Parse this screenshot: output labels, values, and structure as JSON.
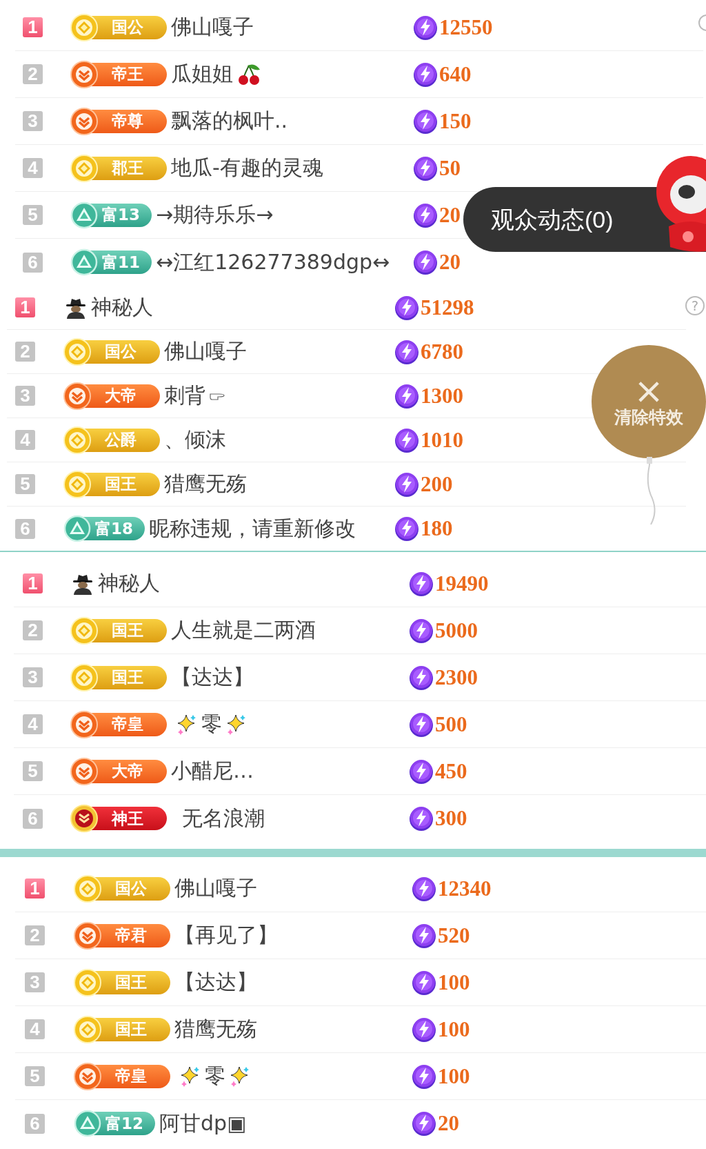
{
  "sections": [
    {
      "help_edge": true,
      "rows": [
        {
          "rank": "1",
          "top": true,
          "kind": "member",
          "badge": {
            "kind": "gold",
            "label": "国公"
          },
          "name": {
            "text": "佛山嘎子",
            "kind": "plain"
          },
          "score": "12550"
        },
        {
          "rank": "2",
          "top": false,
          "kind": "member",
          "badge": {
            "kind": "orange",
            "label": "帝王"
          },
          "name": {
            "text": "瓜姐姐",
            "kind": "cherry"
          },
          "score": "640"
        },
        {
          "rank": "3",
          "top": false,
          "kind": "member",
          "badge": {
            "kind": "orange",
            "label": "帝尊"
          },
          "name": {
            "text": "飘落的枫叶..",
            "kind": "plain"
          },
          "score": "150"
        },
        {
          "rank": "4",
          "top": false,
          "kind": "member",
          "badge": {
            "kind": "gold",
            "label": "郡王"
          },
          "name": {
            "text": "地瓜-有趣的灵魂",
            "kind": "plain"
          },
          "score": "50"
        },
        {
          "rank": "5",
          "top": false,
          "kind": "member",
          "badge": {
            "kind": "teal",
            "label": "富13"
          },
          "name": {
            "text": "→期待乐乐→",
            "kind": "plain"
          },
          "score": "20"
        },
        {
          "rank": "6",
          "top": false,
          "kind": "member",
          "badge": {
            "kind": "teal",
            "label": "富11"
          },
          "name": {
            "text": "↔江红126277389dgp↔",
            "kind": "plain"
          },
          "score": "20"
        }
      ]
    },
    {
      "help": "?",
      "rows": [
        {
          "rank": "1",
          "top": true,
          "kind": "hidden",
          "name": {
            "text": "神秘人",
            "kind": "plain"
          },
          "score": "51298"
        },
        {
          "rank": "2",
          "top": false,
          "kind": "member",
          "badge": {
            "kind": "gold",
            "label": "国公"
          },
          "name": {
            "text": "佛山嘎子",
            "kind": "plain"
          },
          "score": "6780"
        },
        {
          "rank": "3",
          "top": false,
          "kind": "member",
          "badge": {
            "kind": "orange",
            "label": "大帝"
          },
          "name": {
            "text": "刺背",
            "kind": "pointer"
          },
          "score": "1300"
        },
        {
          "rank": "4",
          "top": false,
          "kind": "member",
          "badge": {
            "kind": "gold",
            "label": "公爵"
          },
          "name": {
            "text": "、倾沫",
            "kind": "plain"
          },
          "score": "1010"
        },
        {
          "rank": "5",
          "top": false,
          "kind": "member",
          "badge": {
            "kind": "gold",
            "label": "国王"
          },
          "name": {
            "text": "猎鹰无殇",
            "kind": "plain"
          },
          "score": "200"
        },
        {
          "rank": "6",
          "top": false,
          "kind": "member",
          "badge": {
            "kind": "teal",
            "label": "富18"
          },
          "name": {
            "text": "昵称违规，请重新修改",
            "kind": "plain"
          },
          "score": "180"
        }
      ]
    },
    {
      "rows": [
        {
          "rank": "1",
          "top": true,
          "kind": "hidden",
          "name": {
            "text": "神秘人",
            "kind": "plain"
          },
          "score": "19490"
        },
        {
          "rank": "2",
          "top": false,
          "kind": "member",
          "badge": {
            "kind": "gold",
            "label": "国王"
          },
          "name": {
            "text": "人生就是二两酒",
            "kind": "plain"
          },
          "score": "5000"
        },
        {
          "rank": "3",
          "top": false,
          "kind": "member",
          "badge": {
            "kind": "gold",
            "label": "国王"
          },
          "name": {
            "text": "【达达】",
            "kind": "plain"
          },
          "score": "2300"
        },
        {
          "rank": "4",
          "top": false,
          "kind": "member",
          "badge": {
            "kind": "orange",
            "label": "帝皇"
          },
          "name": {
            "text": "零",
            "kind": "sparkle"
          },
          "score": "500"
        },
        {
          "rank": "5",
          "top": false,
          "kind": "member",
          "badge": {
            "kind": "orange",
            "label": "大帝"
          },
          "name": {
            "text": "小醋尼…",
            "kind": "plain"
          },
          "score": "450"
        },
        {
          "rank": "6",
          "top": false,
          "kind": "member",
          "badge": {
            "kind": "red",
            "label": "神王"
          },
          "name": {
            "text": "无名浪潮",
            "kind": "plain"
          },
          "score": "300"
        }
      ]
    },
    {
      "rows": [
        {
          "rank": "1",
          "top": true,
          "kind": "member",
          "badge": {
            "kind": "gold",
            "label": "国公"
          },
          "name": {
            "text": "佛山嘎子",
            "kind": "plain"
          },
          "score": "12340"
        },
        {
          "rank": "2",
          "top": false,
          "kind": "member",
          "badge": {
            "kind": "orange",
            "label": "帝君"
          },
          "name": {
            "text": "【再见了】",
            "kind": "plain"
          },
          "score": "520"
        },
        {
          "rank": "3",
          "top": false,
          "kind": "member",
          "badge": {
            "kind": "gold",
            "label": "国王"
          },
          "name": {
            "text": "【达达】",
            "kind": "plain"
          },
          "score": "100"
        },
        {
          "rank": "4",
          "top": false,
          "kind": "member",
          "badge": {
            "kind": "gold",
            "label": "国王"
          },
          "name": {
            "text": "猎鹰无殇",
            "kind": "plain"
          },
          "score": "100"
        },
        {
          "rank": "5",
          "top": false,
          "kind": "member",
          "badge": {
            "kind": "orange",
            "label": "帝皇"
          },
          "name": {
            "text": "零",
            "kind": "sparkle"
          },
          "score": "100"
        },
        {
          "rank": "6",
          "top": false,
          "kind": "member",
          "badge": {
            "kind": "teal",
            "label": "富12"
          },
          "name": {
            "text": "阿甘dp▣",
            "kind": "plain"
          },
          "score": "20"
        }
      ]
    }
  ],
  "audience_pill": {
    "label": "观众动态(0)"
  },
  "clear_effects": {
    "icon": "×",
    "label": "清除特效"
  }
}
